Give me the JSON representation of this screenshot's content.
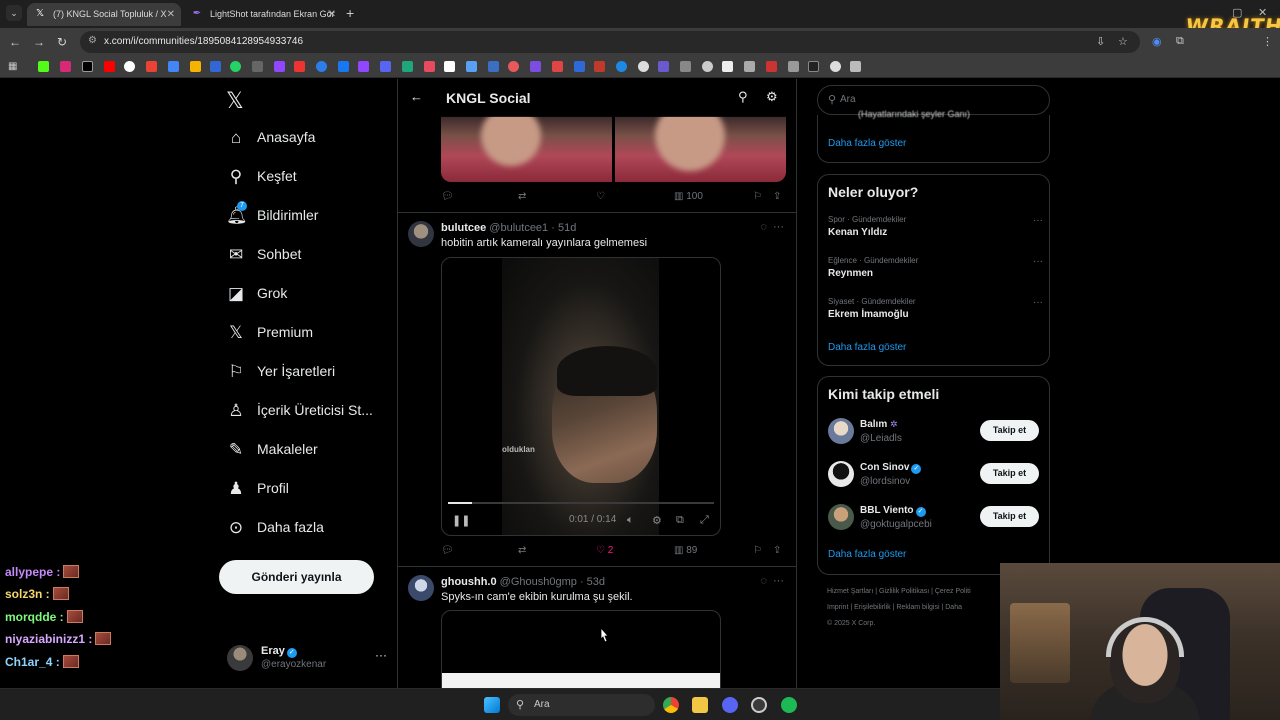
{
  "browser": {
    "tabs": [
      {
        "title": "(7) KNGL Social Topluluk / X",
        "active": true
      },
      {
        "title": "LightShot tarafından Ekran Gör",
        "active": false
      }
    ],
    "url": "x.com/i/communities/1895084128954933746",
    "overlay_logo": "WRAITH"
  },
  "sidebar": {
    "items": [
      {
        "label": "Anasayfa",
        "icon": "home-icon"
      },
      {
        "label": "Keşfet",
        "icon": "search-icon"
      },
      {
        "label": "Bildirimler",
        "icon": "bell-icon",
        "badge": "7"
      },
      {
        "label": "Sohbet",
        "icon": "mail-icon"
      },
      {
        "label": "Grok",
        "icon": "grok-icon"
      },
      {
        "label": "Premium",
        "icon": "x-logo-icon"
      },
      {
        "label": "Yer İşaretleri",
        "icon": "bookmark-icon"
      },
      {
        "label": "İçerik Üreticisi St...",
        "icon": "creator-icon"
      },
      {
        "label": "Makaleler",
        "icon": "article-icon"
      },
      {
        "label": "Profil",
        "icon": "person-icon"
      },
      {
        "label": "Daha fazla",
        "icon": "more-circle-icon"
      }
    ],
    "post_button": "Gönderi yayınla",
    "account": {
      "name": "Eray",
      "handle": "@erayozkenar"
    }
  },
  "chat": [
    {
      "user": "ally pepe",
      "text": "allypepe :",
      "color": "#c58af9"
    },
    {
      "user": "solz3n",
      "text": "solz3n :",
      "color": "#f5d76e"
    },
    {
      "user": "morqdde",
      "text": "morqdde :",
      "color": "#7dfa7d"
    },
    {
      "user": "niyaziabinizz1",
      "text": "niyaziabinizz1 :",
      "color": "#d7a8ff"
    },
    {
      "user": "Ch1ar_4",
      "text": "Ch1ar_4 :",
      "color": "#8fd3ff"
    }
  ],
  "feed": {
    "title": "KNGL Social",
    "first_post_stats": {
      "views": "100"
    },
    "posts": [
      {
        "name": "bulutcee",
        "handle": "@bulutcee1",
        "time": "· 51d",
        "text": "hobitin artık kameralı yayınlara gelmemesi",
        "video": {
          "watermark": "olduklan",
          "time": "0:01 / 0:14"
        },
        "likes": "2",
        "views": "89"
      },
      {
        "name": "ghoushh.0",
        "handle": "@Ghoush0gmp",
        "time": "· 53d",
        "text": "Spyks-ın cam'e ekibin kurulma şu şekil."
      }
    ]
  },
  "right": {
    "search_placeholder": "Ara",
    "top_card": {
      "partial_text": "(Hayatlarındaki şeyler Ganı)",
      "more": "Daha fazla göster"
    },
    "trends": {
      "heading": "Neler oluyor?",
      "items": [
        {
          "category": "Spor · Gündemdekiler",
          "name": "Kenan Yıldız"
        },
        {
          "category": "Eğlence · Gündemdekiler",
          "name": "Reynmen"
        },
        {
          "category": "Siyaset · Gündemdekiler",
          "name": "Ekrem İmamoğlu"
        }
      ],
      "more": "Daha fazla göster"
    },
    "who_to_follow": {
      "heading": "Kimi takip etmeli",
      "items": [
        {
          "name": "Balım",
          "handle": "@Leiadls",
          "button": "Takip et"
        },
        {
          "name": "Con Sinov",
          "handle": "@lordsinov",
          "button": "Takip et"
        },
        {
          "name": "BBL Viento",
          "handle": "@goktugalpcebi",
          "button": "Takip et"
        }
      ],
      "more": "Daha fazla göster"
    },
    "footer": {
      "line1": "Hizmet Şartları  |  Gizlilik Politikası  |  Çerez Politi",
      "line2": "Imprint  |  Erişilebilirlik  |  Reklam bilgisi  |  Daha",
      "line3": "© 2025 X Corp."
    }
  },
  "taskbar": {
    "search_placeholder": "Ara"
  }
}
